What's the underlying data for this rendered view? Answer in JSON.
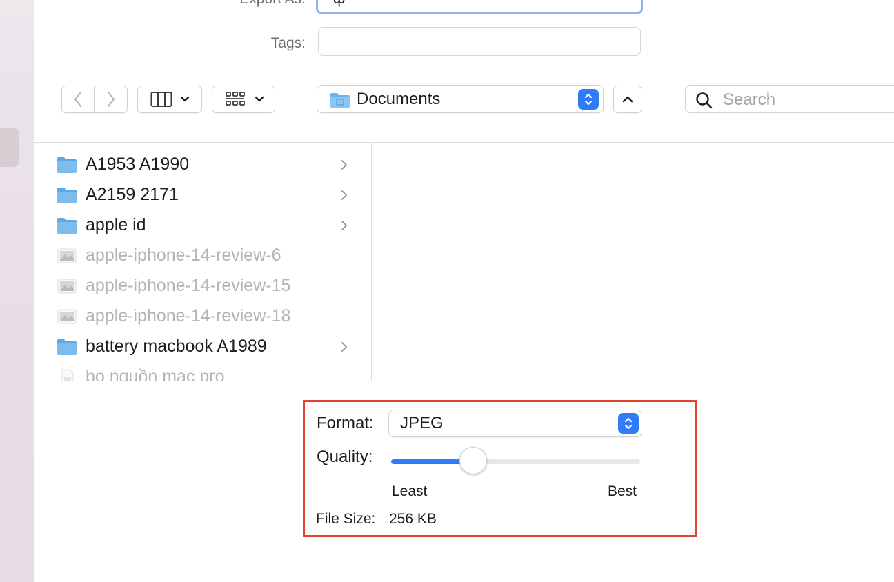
{
  "dialog": {
    "export_as_label": "Export As:",
    "export_as_value": "ф",
    "tags_label": "Tags:",
    "tags_value": ""
  },
  "toolbar": {
    "back_icon": "chevron-left-icon",
    "forward_icon": "chevron-right-icon",
    "column_view_icon": "column-view-icon",
    "group_icon": "icon-grid-icon",
    "location": "Documents",
    "search_placeholder": "Search"
  },
  "browser": {
    "items": [
      {
        "name": "A1953 A1990",
        "kind": "folder",
        "enabled": true
      },
      {
        "name": "A2159 2171",
        "kind": "folder",
        "enabled": true
      },
      {
        "name": "apple id",
        "kind": "folder",
        "enabled": true
      },
      {
        "name": "apple-iphone-14-review-6",
        "kind": "image",
        "enabled": false
      },
      {
        "name": "apple-iphone-14-review-15",
        "kind": "image",
        "enabled": false
      },
      {
        "name": "apple-iphone-14-review-18",
        "kind": "image",
        "enabled": false
      },
      {
        "name": "battery macbook A1989",
        "kind": "folder",
        "enabled": true
      },
      {
        "name": "bo nguồn mac pro",
        "kind": "document",
        "enabled": false
      }
    ]
  },
  "options": {
    "format_label": "Format:",
    "format_value": "JPEG",
    "quality_label": "Quality:",
    "quality_value": 0.33,
    "least_label": "Least",
    "best_label": "Best",
    "file_size_label": "File Size:",
    "file_size_value": "256 KB"
  },
  "colors": {
    "accent": "#2f7cf6",
    "highlight_border": "#e0432f",
    "folder": "#6db3ea"
  }
}
